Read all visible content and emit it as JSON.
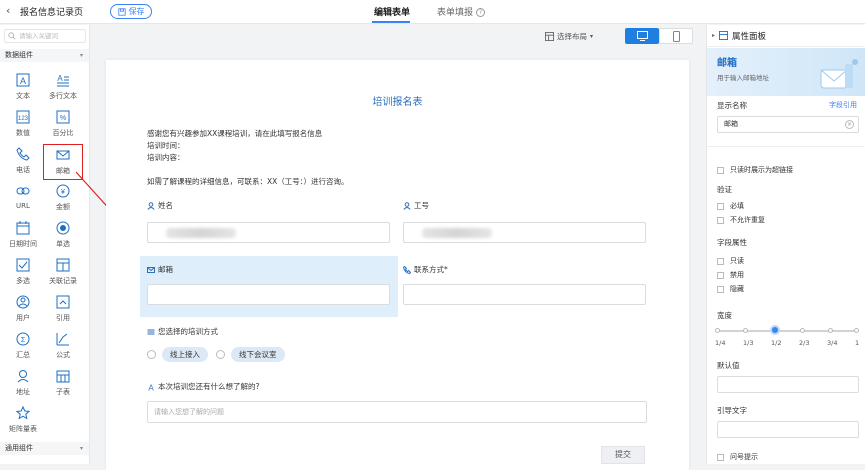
{
  "header": {
    "back_icon": "chevron-left-icon",
    "title": "报名信息记录页",
    "save_label": "保存",
    "tabs": [
      {
        "label": "编辑表单",
        "active": true
      },
      {
        "label": "表单填报",
        "active": false
      }
    ]
  },
  "left": {
    "search_placeholder": "请输入关键词",
    "group_data": "数据组件",
    "group_common": "通用组件",
    "components": [
      {
        "label": "文本",
        "icon": "text-icon"
      },
      {
        "label": "多行文本",
        "icon": "multiline-text-icon"
      },
      {
        "label": "数值",
        "icon": "number-icon"
      },
      {
        "label": "百分比",
        "icon": "percent-icon"
      },
      {
        "label": "电话",
        "icon": "phone-icon"
      },
      {
        "label": "邮箱",
        "icon": "mail-icon"
      },
      {
        "label": "URL",
        "icon": "link-icon"
      },
      {
        "label": "金额",
        "icon": "money-icon"
      },
      {
        "label": "日期时间",
        "icon": "calendar-icon"
      },
      {
        "label": "单选",
        "icon": "radio-icon"
      },
      {
        "label": "多选",
        "icon": "checkbox-icon"
      },
      {
        "label": "关联记录",
        "icon": "relation-icon"
      },
      {
        "label": "用户",
        "icon": "user-icon"
      },
      {
        "label": "引用",
        "icon": "reference-icon"
      },
      {
        "label": "汇总",
        "icon": "summary-icon"
      },
      {
        "label": "公式",
        "icon": "formula-icon"
      },
      {
        "label": "地址",
        "icon": "location-icon"
      },
      {
        "label": "子表",
        "icon": "subtable-icon"
      },
      {
        "label": "矩阵量表",
        "icon": "star-icon"
      }
    ]
  },
  "toolbar": {
    "layout_label": "选择布局"
  },
  "form": {
    "title": "培训报名表",
    "intro_line1": "感谢您有兴趣参加XX课程培训，请在此填写报名信息",
    "intro_line2": "培训时间：",
    "intro_line3": "培训内容：",
    "intro_line4": "如需了解课程的详细信息，可联系：XX（工号：）进行咨询。",
    "field_name": "姓名",
    "field_id": "工号",
    "field_email": "邮箱",
    "field_contact": "联系方式*",
    "field_training": "您选择的培训方式",
    "option_online": "线上接入",
    "option_offline": "线下会议室",
    "field_question": "本次培训您还有什么想了解的?",
    "question_placeholder": "请输入您想了解的问题",
    "submit_label": "提交"
  },
  "right": {
    "panel_title": "属性面板",
    "card_title": "邮箱",
    "card_subtitle": "用于输入邮箱地址",
    "display_name_label": "显示名称",
    "field_ref_link": "字段引用",
    "display_name_value": "邮箱",
    "readonly_link_label": "只读时展示为超链接",
    "validation_label": "验证",
    "required_label": "必填",
    "no_duplicate_label": "不允许重复",
    "attr_label": "字段属性",
    "readonly_label": "只读",
    "disabled_label": "禁用",
    "hidden_label": "隐藏",
    "width_label": "宽度",
    "width_value": "1/2",
    "width_ticks": [
      "1/4",
      "1/3",
      "1/2",
      "2/3",
      "3/4",
      "1"
    ],
    "default_label": "默认值",
    "guide_label": "引导文字",
    "hint_label": "问号提示"
  }
}
